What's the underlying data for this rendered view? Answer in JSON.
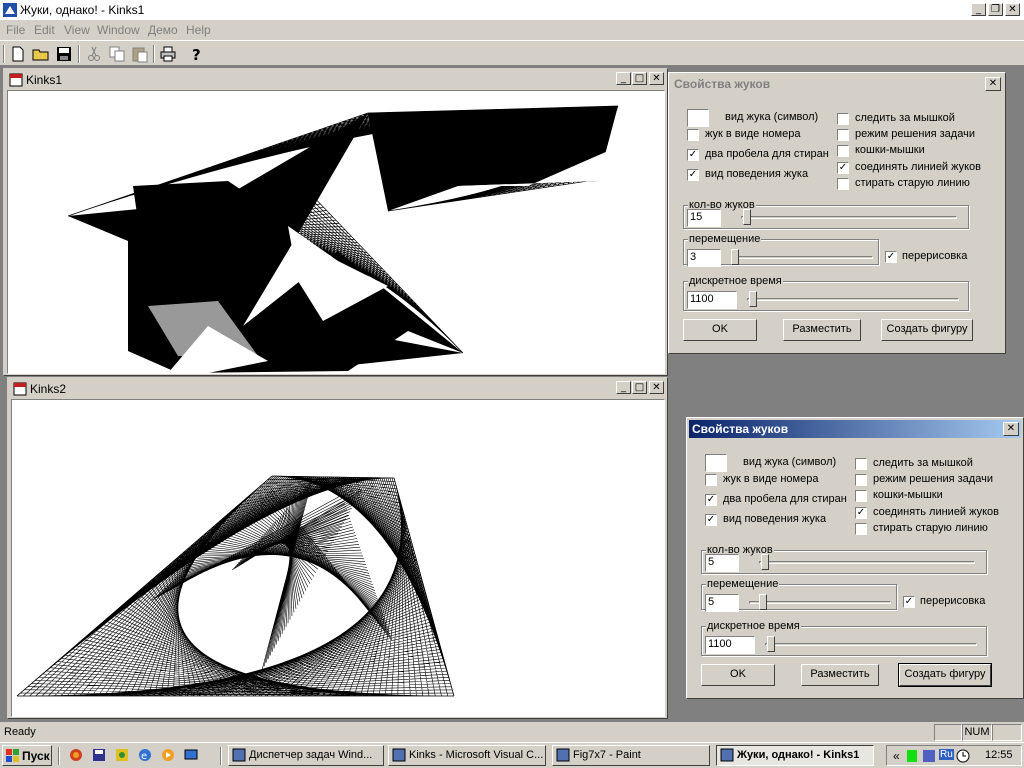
{
  "app": {
    "title": "Жуки, однако! - Kinks1"
  },
  "menu": [
    "File",
    "Edit",
    "View",
    "Window",
    "Демо",
    "Help"
  ],
  "windows": [
    {
      "title": "Kinks1"
    },
    {
      "title": "Kinks2"
    }
  ],
  "dialogs": [
    {
      "title": "Свойства жуков",
      "state": "inactive",
      "checks_left": [
        {
          "label": "вид жука (символ)",
          "checked": false,
          "is_symbol": true
        },
        {
          "label": "жук в виде номера",
          "checked": false
        },
        {
          "label": "два пробела для стиран",
          "checked": true
        },
        {
          "label": "вид поведения жука",
          "checked": true
        }
      ],
      "checks_right": [
        {
          "label": "следить за мышкой",
          "checked": false
        },
        {
          "label": "режим решения задачи",
          "checked": false
        },
        {
          "label": "кошки-мышки",
          "checked": false
        },
        {
          "label": "соединять линией жуков",
          "checked": true
        },
        {
          "label": "стирать старую линию",
          "checked": false
        }
      ],
      "bug_count": {
        "label": "кол-во жуков",
        "value": "15"
      },
      "movement": {
        "label": "перемещение",
        "value": "3"
      },
      "redraw": {
        "label": "перерисовка",
        "checked": true
      },
      "discrete_time": {
        "label": "дискретное время",
        "value": "1100"
      },
      "buttons": {
        "ok": "OK",
        "place": "Разместить",
        "create": "Создать фигуру"
      }
    },
    {
      "title": "Свойства жуков",
      "state": "active",
      "checks_left": [
        {
          "label": "вид жука (символ)",
          "checked": false,
          "is_symbol": true
        },
        {
          "label": "жук в виде номера",
          "checked": false
        },
        {
          "label": "два пробела для стиран",
          "checked": true
        },
        {
          "label": "вид поведения жука",
          "checked": true
        }
      ],
      "checks_right": [
        {
          "label": "следить за мышкой",
          "checked": false
        },
        {
          "label": "режим решения задачи",
          "checked": false
        },
        {
          "label": "кошки-мышки",
          "checked": false
        },
        {
          "label": "соединять линией жуков",
          "checked": true
        },
        {
          "label": "стирать старую линию",
          "checked": false
        }
      ],
      "bug_count": {
        "label": "кол-во жуков",
        "value": "5"
      },
      "movement": {
        "label": "перемещение",
        "value": "5"
      },
      "redraw": {
        "label": "перерисовка",
        "checked": true
      },
      "discrete_time": {
        "label": "дискретное время",
        "value": "1100"
      },
      "buttons": {
        "ok": "OK",
        "place": "Разместить",
        "create": "Создать фигуру"
      }
    }
  ],
  "status": {
    "text": "Ready",
    "num": "NUM"
  },
  "taskbar": {
    "start": "Пуск",
    "tasks": [
      {
        "label": "Диспетчер задач Wind...",
        "active": false
      },
      {
        "label": "Kinks - Microsoft Visual C...",
        "active": false
      },
      {
        "label": "Fig7x7 - Paint",
        "active": false
      },
      {
        "label": "Жуки, однако! - Kinks1",
        "active": true
      }
    ],
    "chevron": "«",
    "lang": "Ru",
    "clock": "12:55"
  }
}
